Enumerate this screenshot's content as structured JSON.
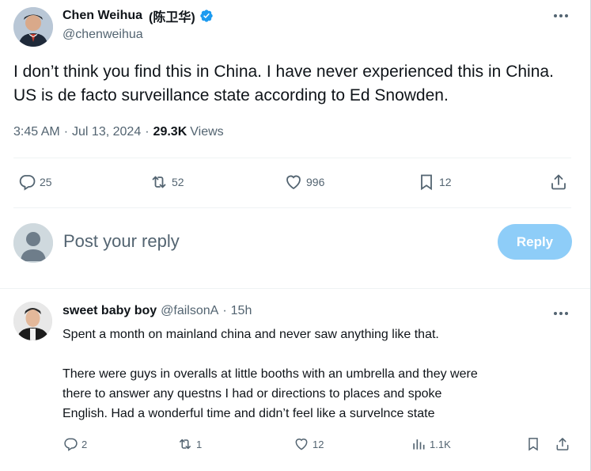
{
  "tweet": {
    "author_name": "Chen Weihua",
    "author_name_cn": "(陈卫华)",
    "handle": "@chenweihua",
    "text": "I don’t think you find this in China. I have never experienced this in China. US is de facto surveillance state according to Ed Snowden.",
    "time": "3:45 AM",
    "date": "Jul 13, 2024",
    "views_count": "29.3K",
    "views_label": "Views",
    "replies": "25",
    "reposts": "52",
    "likes": "996",
    "bookmarks": "12",
    "verified_color": "#1d9bf0"
  },
  "composer": {
    "placeholder": "Post your reply",
    "reply_button": "Reply",
    "button_color": "#8ecdf8"
  },
  "reply": {
    "author_name": "sweet baby boy",
    "handle": "@failsonA",
    "time_ago": "15h",
    "paragraph1": "Spent a month on mainland china and never saw anything like that.",
    "paragraph2_line1": "There were guys in overalls at little booths with an umbrella and they were",
    "paragraph2_line2": "there to answer any questns I had or directions to places and spoke",
    "paragraph2_line3": "English. Had a wonderful time and didn’t feel like a survelnce state",
    "replies": "2",
    "reposts": "1",
    "likes": "12",
    "views": "1.1K"
  },
  "icons": [
    "more-icon",
    "reply-icon",
    "repost-icon",
    "like-icon",
    "bookmark-icon",
    "share-icon",
    "views-icon",
    "verified-icon"
  ]
}
